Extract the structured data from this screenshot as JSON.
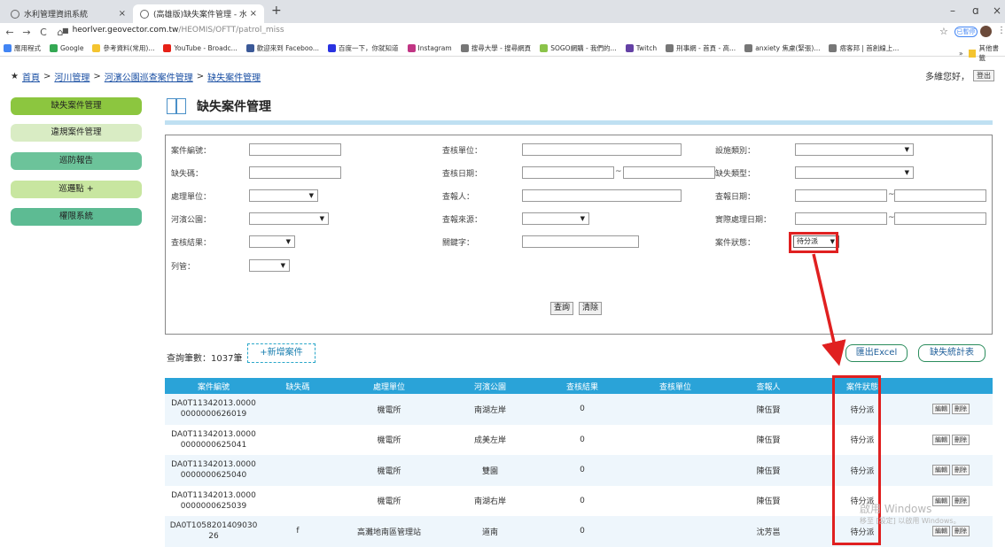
{
  "browser": {
    "tabs": [
      {
        "title": "水利管理資訊系統"
      },
      {
        "title": "(高雄版)缺失案件管理 - 水利署"
      }
    ],
    "tab_close": "×",
    "new_tab": "+",
    "window_controls": [
      "–",
      "ɑ",
      "×"
    ],
    "url_host": "heorlver.geovector.com.tw",
    "url_path": "/HEOMIS/OFTT/patrol_miss",
    "ext_label": "已暫停",
    "bookmarks": [
      "應用程式",
      "Google",
      "參考資料(常用)...",
      "YouTube - Broadc...",
      "歡迎來到 Faceboo...",
      "百度一下，你就知道",
      "Instagram",
      "搜尋大學 - 搜尋網頁",
      "SOGO網購 - 我們的...",
      "Twitch",
      "刑事網 - 首頁 - 高...",
      "anxiety 焦慮(緊張)...",
      "痞客邦 | 首創線上..."
    ],
    "bookmarks_end": "其他書籤"
  },
  "header": {
    "breadcrumb": [
      "首頁",
      "河川管理",
      "河濱公園巡查案件管理",
      "缺失案件管理"
    ],
    "breadcrumb_sep": ">",
    "greeting": "多維您好，",
    "logout": "登出"
  },
  "sidebar": {
    "items": [
      {
        "label": "缺失案件管理",
        "color": "#8cc63f"
      },
      {
        "label": "違規案件管理",
        "color": "#d9ecc4"
      },
      {
        "label": "巡防報告",
        "color": "#6cc39a"
      },
      {
        "label": "巡邏點 +",
        "color": "#c8e6a0"
      },
      {
        "label": "權限系統",
        "color": "#5dbb93"
      }
    ]
  },
  "page": {
    "title": "缺失案件管理"
  },
  "search_form": {
    "case_no": "案件編號：",
    "check_unit": "查核單位：",
    "facility_type": "設施類別：",
    "defect_code": "缺失碼：",
    "check_date": "查核日期：",
    "defect_type": "缺失類型：",
    "handle_unit": "處理單位：",
    "reporter": "查報人：",
    "report_date": "查報日期：",
    "river_park": "河濱公園：",
    "report_source": "查報來源：",
    "actual_date": "實際處理日期：",
    "check_result": "查核結果：",
    "keyword": "關鍵字：",
    "case_status": "案件狀態：",
    "case_status_value": "待分派",
    "column": "列管：",
    "tilde": "~",
    "query_btn": "查詢",
    "clear_btn": "清除",
    "select_arrow": "▼"
  },
  "results": {
    "count_label": "查詢筆數：1037筆",
    "add_button": "+新增案件",
    "export_button": "匯出Excel",
    "stats_button": "缺失統計表",
    "columns": [
      "案件編號",
      "缺失碼",
      "處理單位",
      "河濱公園",
      "查核結果",
      "查核單位",
      "查報人",
      "案件狀態",
      ""
    ],
    "edit_label": "編輯",
    "delete_label": "刪除",
    "rows": [
      {
        "id1": "DA0T11342013.0000",
        "id2": "0000000626019",
        "code": "",
        "unit": "機電所",
        "park": "南湖左岸",
        "result": "0",
        "check_unit": "",
        "reporter": "陳伍賢",
        "status": "待分派"
      },
      {
        "id1": "DA0T11342013.0000",
        "id2": "0000000625041",
        "code": "",
        "unit": "機電所",
        "park": "成美左岸",
        "result": "0",
        "check_unit": "",
        "reporter": "陳伍賢",
        "status": "待分派"
      },
      {
        "id1": "DA0T11342013.0000",
        "id2": "0000000625040",
        "code": "",
        "unit": "機電所",
        "park": "雙園",
        "result": "0",
        "check_unit": "",
        "reporter": "陳伍賢",
        "status": "待分派"
      },
      {
        "id1": "DA0T11342013.0000",
        "id2": "0000000625039",
        "code": "",
        "unit": "機電所",
        "park": "南湖右岸",
        "result": "0",
        "check_unit": "",
        "reporter": "陳伍賢",
        "status": "待分派"
      },
      {
        "id1": "DA0T1058201409030",
        "id2": "26",
        "code": "f",
        "unit": "高灘地南區管理站",
        "park": "道南",
        "result": "0",
        "check_unit": "",
        "reporter": "沈芳邕",
        "status": "待分派"
      }
    ]
  },
  "watermark": {
    "line1": "啟用 Windows",
    "line2": "移至 [設定] 以啟用 Windows。"
  },
  "colors": {
    "header_blue": "#2aa3d8",
    "annotation_red": "#e02020"
  }
}
